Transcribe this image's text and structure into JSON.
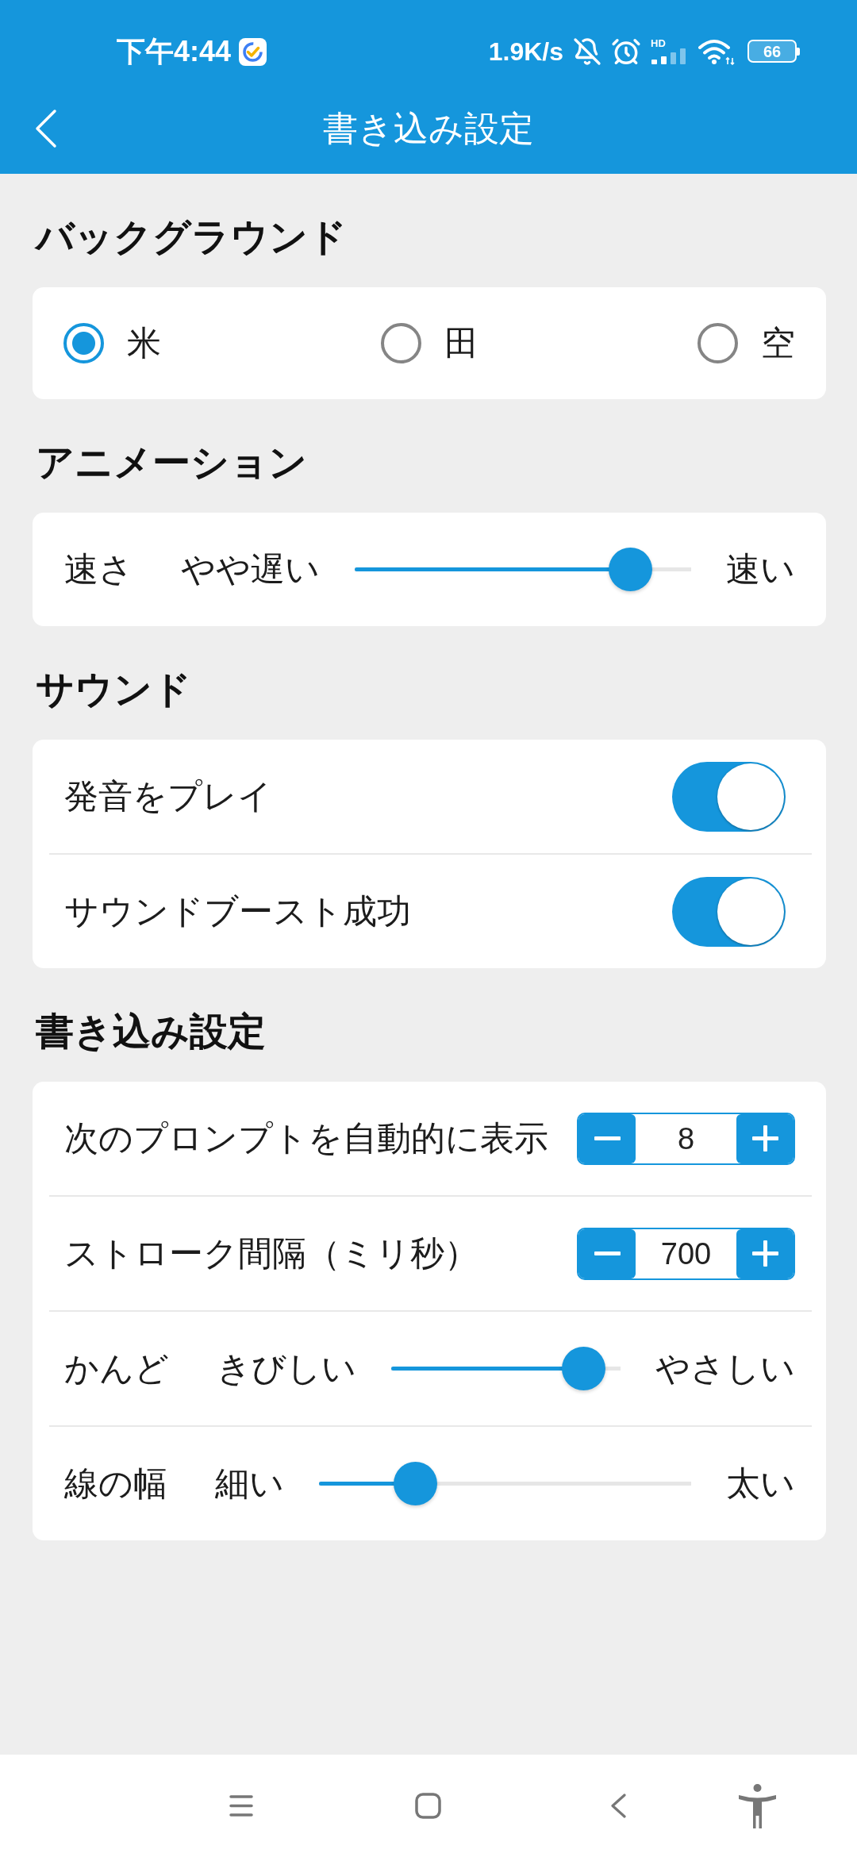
{
  "status_bar": {
    "time": "下午4:44",
    "network_speed": "1.9K/s",
    "signal_label": "HD",
    "battery": "66"
  },
  "app_bar": {
    "title": "書き込み設定"
  },
  "sections": [
    {
      "kind": "radio",
      "title": "バックグラウンド",
      "options": [
        {
          "label": "米",
          "selected": true
        },
        {
          "label": "田",
          "selected": false
        },
        {
          "label": "空",
          "selected": false
        }
      ]
    },
    {
      "kind": "list",
      "title": "アニメーション",
      "rows": [
        {
          "kind": "slider",
          "label": "速さ",
          "min_label": "やや遅い",
          "max_label": "速い",
          "level": 0.82
        }
      ]
    },
    {
      "kind": "list",
      "title": "サウンド",
      "rows": [
        {
          "kind": "toggle",
          "label": "発音をプレイ",
          "on": true
        },
        {
          "kind": "toggle",
          "label": "サウンドブースト成功",
          "on": true
        }
      ]
    },
    {
      "kind": "list",
      "title": "書き込み設定",
      "rows": [
        {
          "kind": "stepper",
          "label": "次のプロンプトを自動的に表示",
          "value": "8"
        },
        {
          "kind": "stepper",
          "label": "ストローク間隔（ミリ秒）",
          "value": "700"
        },
        {
          "kind": "slider",
          "label": "かんど",
          "min_label": "きびしい",
          "max_label": "やさしい",
          "level": 0.84
        },
        {
          "kind": "slider",
          "label": "線の幅",
          "min_label": "細い",
          "max_label": "太い",
          "level": 0.26
        }
      ]
    }
  ]
}
